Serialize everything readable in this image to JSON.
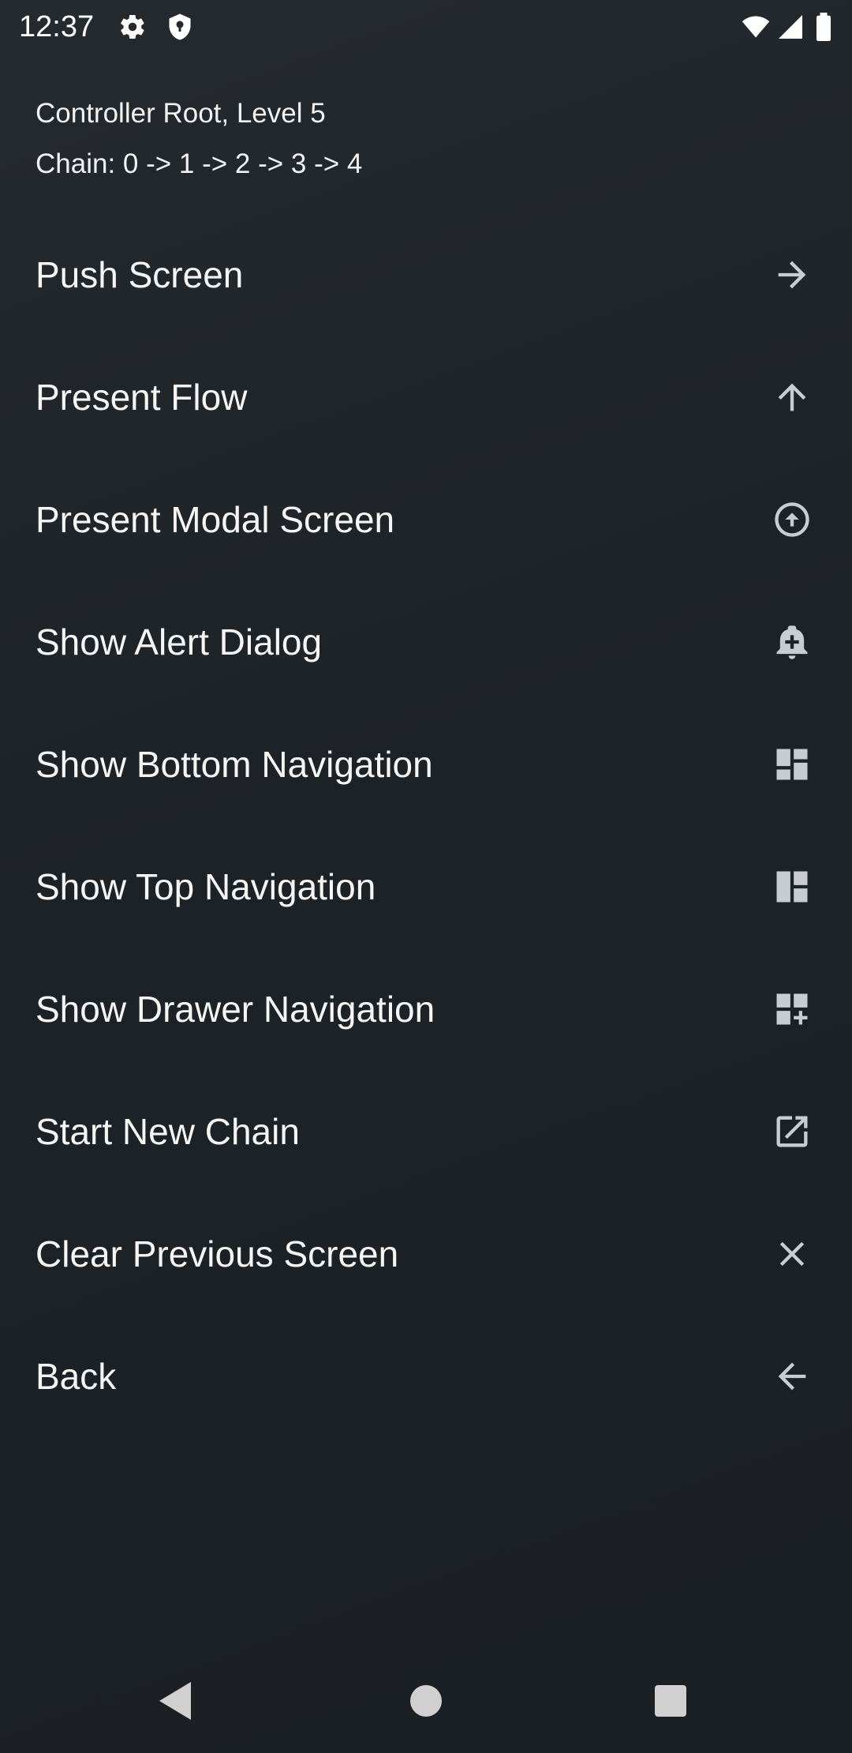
{
  "status_bar": {
    "time": "12:37",
    "icons": [
      "settings-icon",
      "shield-icon",
      "wifi-icon",
      "signal-icon",
      "battery-icon"
    ]
  },
  "header": {
    "title": "Controller Root, Level 5",
    "chain": "Chain: 0 -> 1 -> 2 -> 3 -> 4"
  },
  "menu": {
    "items": [
      {
        "label": "Push Screen",
        "icon": "arrow-forward-icon"
      },
      {
        "label": "Present Flow",
        "icon": "arrow-upward-icon"
      },
      {
        "label": "Present Modal Screen",
        "icon": "arrow-circle-up-icon"
      },
      {
        "label": "Show Alert Dialog",
        "icon": "add-alert-icon"
      },
      {
        "label": "Show Bottom Navigation",
        "icon": "dashboard-icon"
      },
      {
        "label": "Show Top Navigation",
        "icon": "view-quilt-icon"
      },
      {
        "label": "Show Drawer Navigation",
        "icon": "dashboard-add-icon"
      },
      {
        "label": "Start New Chain",
        "icon": "open-in-new-icon"
      },
      {
        "label": "Clear Previous Screen",
        "icon": "close-icon"
      },
      {
        "label": "Back",
        "icon": "arrow-back-icon"
      }
    ]
  },
  "nav_bar": {
    "buttons": [
      "back-triangle-icon",
      "home-circle-icon",
      "recents-square-icon"
    ]
  },
  "colors": {
    "background": "#1e2328",
    "text": "#f5f5f5",
    "icon": "#c9cdd1"
  }
}
